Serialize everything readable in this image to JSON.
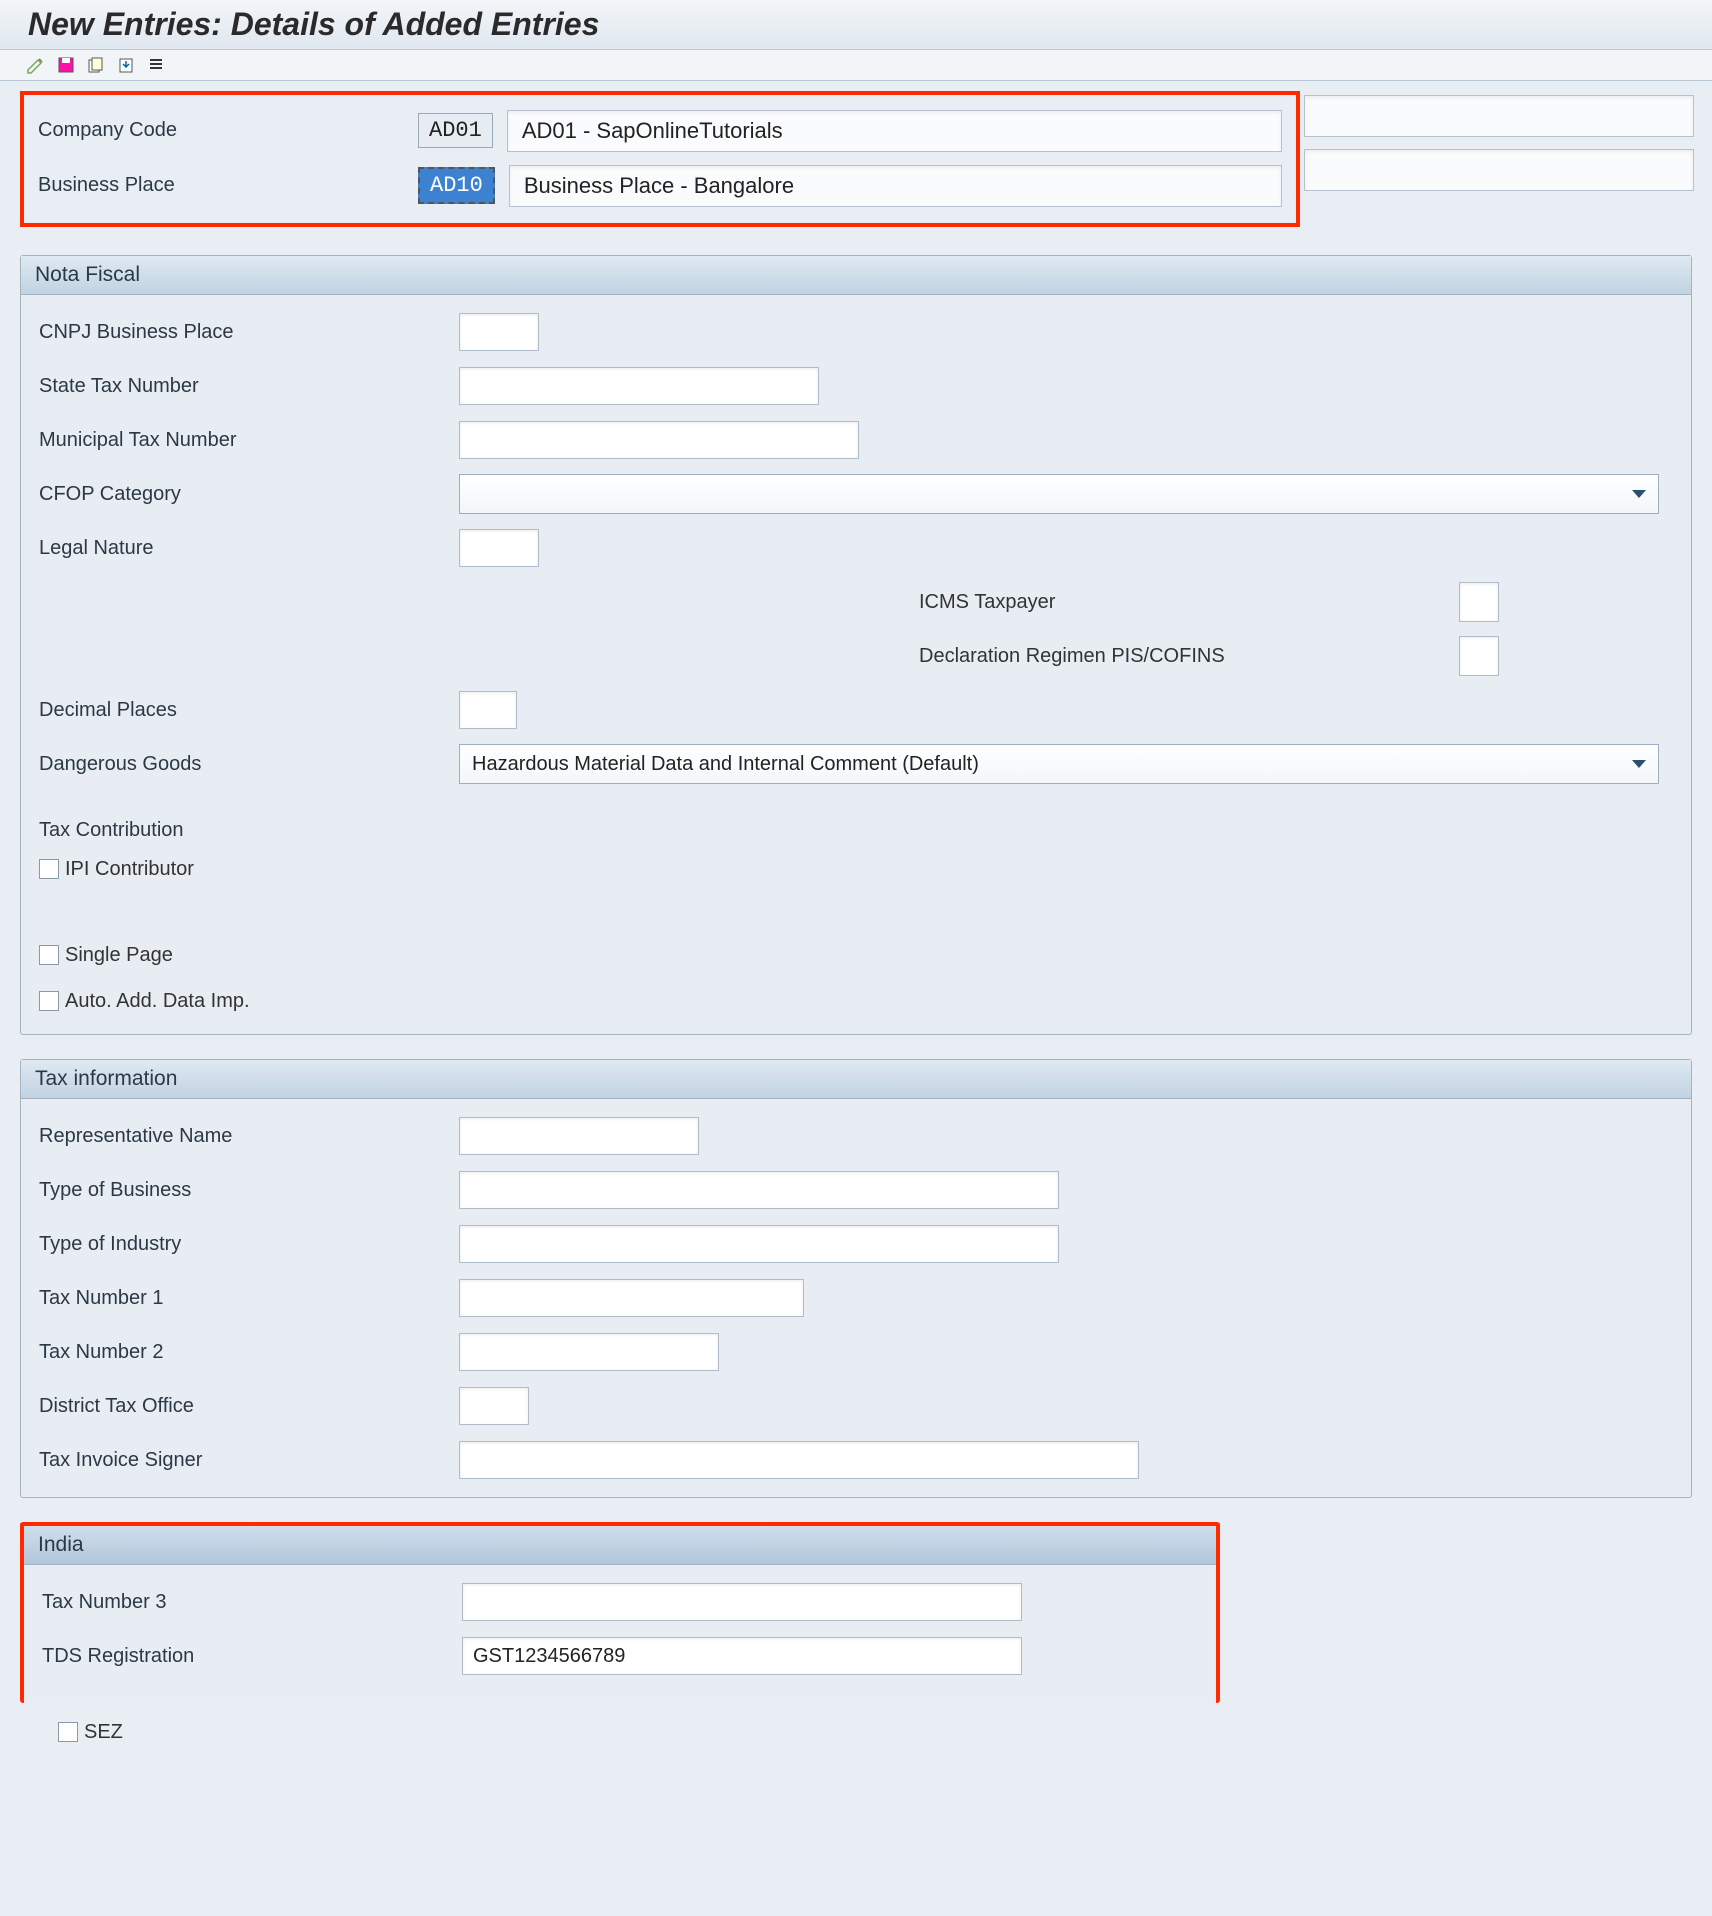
{
  "title": "New Entries: Details of Added Entries",
  "toolbar": [
    "edit",
    "save",
    "copy",
    "export",
    "list"
  ],
  "header": {
    "companyCode": {
      "label": "Company Code",
      "code": "AD01",
      "desc": "AD01 - SapOnlineTutorials"
    },
    "businessPlace": {
      "label": "Business Place",
      "code": "AD10",
      "desc": "Business Place - Bangalore"
    }
  },
  "groups": {
    "nota": {
      "title": "Nota Fiscal",
      "fields": {
        "cnpj": {
          "label": "CNPJ Business Place",
          "value": ""
        },
        "state": {
          "label": "State Tax Number",
          "value": ""
        },
        "muni": {
          "label": "Municipal Tax Number",
          "value": ""
        },
        "cfop": {
          "label": "CFOP Category",
          "value": ""
        },
        "legal": {
          "label": "Legal Nature",
          "value": ""
        },
        "icms": {
          "label": "ICMS Taxpayer"
        },
        "decl": {
          "label": "Declaration Regimen PIS/COFINS"
        },
        "dec": {
          "label": "Decimal Places",
          "value": ""
        },
        "dang": {
          "label": "Dangerous Goods",
          "value": "Hazardous Material Data and Internal Comment (Default)"
        }
      },
      "subheader": "Tax Contribution",
      "checks": {
        "ipi": "IPI Contributor",
        "single": "Single Page",
        "auto": "Auto. Add. Data Imp."
      }
    },
    "tax": {
      "title": "Tax information",
      "fields": {
        "rep": {
          "label": "Representative Name",
          "value": ""
        },
        "tbus": {
          "label": "Type of Business",
          "value": ""
        },
        "tind": {
          "label": "Type of Industry",
          "value": ""
        },
        "tax1": {
          "label": "Tax Number 1",
          "value": ""
        },
        "tax2": {
          "label": "Tax Number 2",
          "value": ""
        },
        "dist": {
          "label": "District Tax Office",
          "value": ""
        },
        "sign": {
          "label": "Tax Invoice Signer",
          "value": ""
        }
      }
    },
    "india": {
      "title": "India",
      "fields": {
        "tax3": {
          "label": "Tax Number 3",
          "value": ""
        },
        "tds": {
          "label": "TDS Registration",
          "value": "GST1234566789"
        }
      },
      "checks": {
        "sez": "SEZ"
      }
    }
  }
}
